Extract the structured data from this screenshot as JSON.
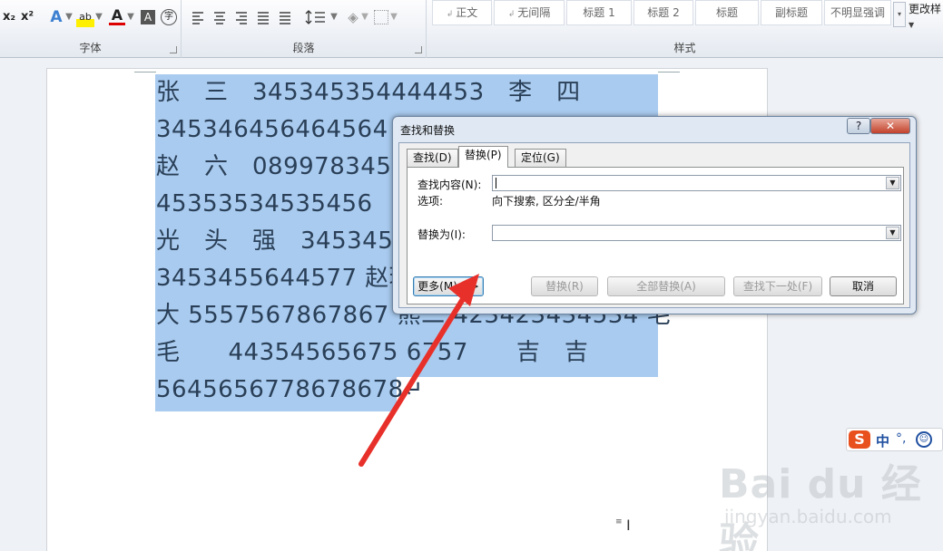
{
  "ribbon": {
    "font_group": {
      "label": "字体",
      "tools": [
        {
          "name": "subscript",
          "text": "x₂"
        },
        {
          "name": "superscript",
          "text": "x²"
        },
        {
          "name": "text-effect",
          "text": "A"
        },
        {
          "name": "highlight",
          "text": "ab"
        },
        {
          "name": "font-color",
          "text": "A"
        },
        {
          "name": "char-shading",
          "text": "A"
        },
        {
          "name": "enclose-char",
          "text": "字"
        }
      ]
    },
    "paragraph_group": {
      "label": "段落"
    },
    "styles_group": {
      "label": "样式",
      "tiles": [
        "正文",
        "无间隔",
        "标题 1",
        "标题 2",
        "标题",
        "副标题",
        "不明显强调"
      ],
      "change_style": "更改样"
    }
  },
  "document": {
    "lines": [
      "张　三　345345354444453　李　四",
      "345346456464564　王　五　345355564645",
      "赵　六　08997834534534　孙　七",
      "45353534535456　二　狗　4534534534",
      "光　头　强　34534534535　熊　大",
      "3453455644577 赵琳 45353455　熊",
      "大 5557567867867 熊二 423423434534 毛",
      "毛　　44354565675 6757　　吉　吉",
      "5645656778678678↵"
    ]
  },
  "dialog": {
    "title": "查找和替换",
    "help": "?",
    "close": "✕",
    "tabs": [
      "查找(D)",
      "替换(P)",
      "定位(G)"
    ],
    "active_tab": "替换(P)",
    "find_label": "查找内容(N):",
    "find_value": "",
    "options_label": "选项:",
    "options_value": "向下搜索, 区分全/半角",
    "replace_label": "替换为(I):",
    "replace_value": "",
    "buttons": {
      "more": "更多(M) >>",
      "replace": "替换(R)",
      "replace_all": "全部替换(A)",
      "find_next": "查找下一处(F)",
      "cancel": "取消"
    }
  },
  "ime": {
    "logo": "S",
    "mode": "中",
    "punct": "°,",
    "emoji": "☺"
  },
  "watermark": {
    "brand": "Bai du 经验",
    "url": "jingyan.baidu.com"
  },
  "colors": {
    "selection": "#a9cbef",
    "arrow": "#e8302a",
    "ime_logo": "#e8501d"
  }
}
